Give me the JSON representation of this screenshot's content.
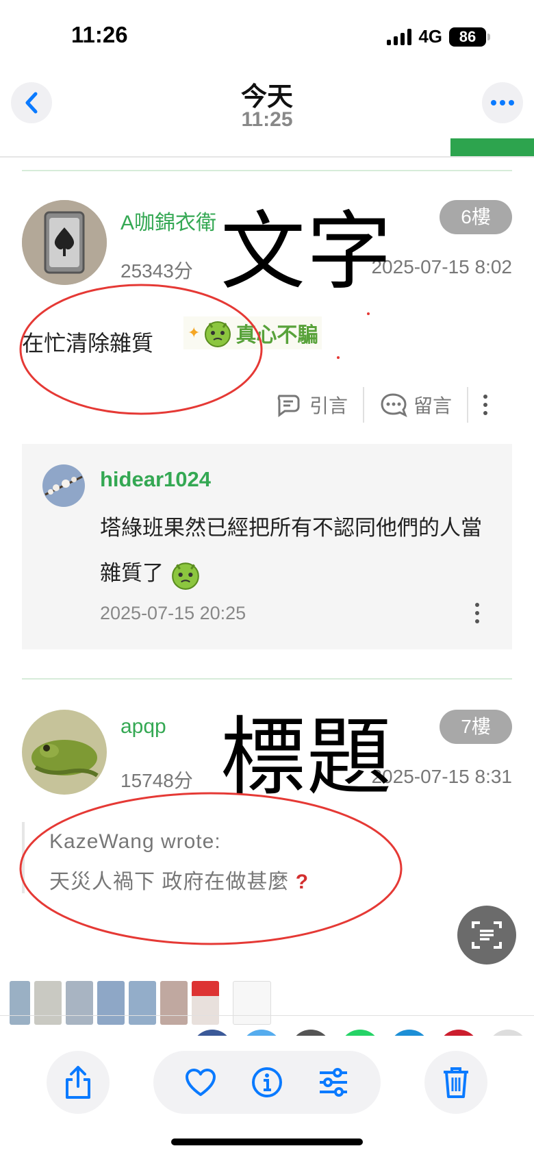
{
  "status_bar": {
    "time": "11:26",
    "network": "4G",
    "battery": "86"
  },
  "header": {
    "title": "今天",
    "subtitle": "11:25"
  },
  "posts": [
    {
      "username": "A咖錦衣衛",
      "score": "25343分",
      "date": "2025-07-15 8:02",
      "floor": "6樓",
      "overlay": "文字",
      "content": "在忙清除雜質",
      "sticker_text": "真心不騙",
      "actions": {
        "quote": "引言",
        "comment": "留言"
      },
      "reply": {
        "username": "hidear1024",
        "text": "塔綠班果然已經把所有不認同他們的人當雜質了",
        "date": "2025-07-15 20:25"
      }
    },
    {
      "username": "apqp",
      "score": "15748分",
      "date": "2025-07-15 8:31",
      "floor": "7樓",
      "overlay": "標題",
      "quote_author": "KazeWang wrote:",
      "quote_text": "天災人禍下 政府在做甚麼"
    }
  ],
  "colors": {
    "accent_green": "#34a853",
    "ios_blue": "#0a7aff",
    "annotation_red": "#e53935"
  },
  "icons": [
    "back-chevron-icon",
    "more-dots-icon",
    "quote-icon",
    "comment-icon",
    "kebab-icon",
    "scan-text-icon",
    "share-icon",
    "heart-icon",
    "info-icon",
    "adjust-icon",
    "trash-icon"
  ]
}
